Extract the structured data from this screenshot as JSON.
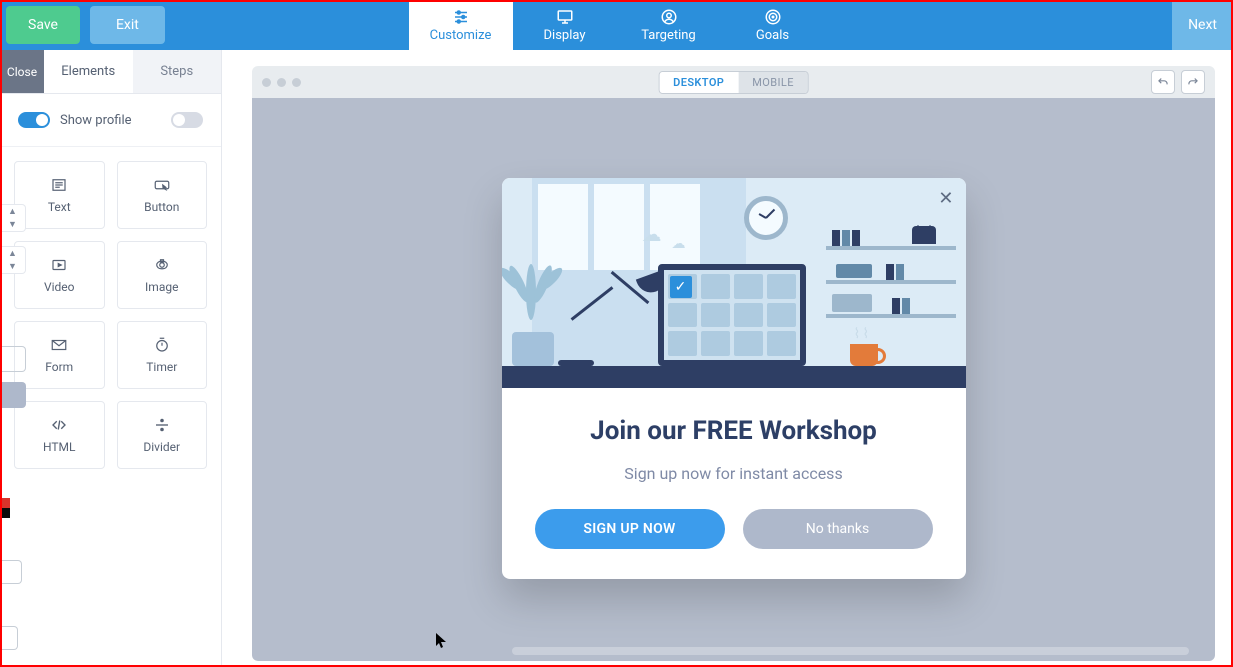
{
  "topbar": {
    "save": "Save",
    "exit": "Exit",
    "next": "Next",
    "nav": [
      {
        "label": "Customize",
        "icon": "sliders",
        "active": true
      },
      {
        "label": "Display",
        "icon": "monitor",
        "active": false
      },
      {
        "label": "Targeting",
        "icon": "target-user",
        "active": false
      },
      {
        "label": "Goals",
        "icon": "bullseye",
        "active": false
      }
    ]
  },
  "sidebar": {
    "tabs": {
      "close": "Close",
      "elements": "Elements",
      "steps": "Steps"
    },
    "active_tab": "Elements",
    "show_profile_label": "Show profile",
    "show_profile_enabled_left": true,
    "show_profile_enabled_right": false,
    "elements": [
      {
        "label": "Text",
        "icon": "text"
      },
      {
        "label": "Button",
        "icon": "button"
      },
      {
        "label": "Video",
        "icon": "video"
      },
      {
        "label": "Image",
        "icon": "image"
      },
      {
        "label": "Form",
        "icon": "form"
      },
      {
        "label": "Timer",
        "icon": "timer"
      },
      {
        "label": "HTML",
        "icon": "html"
      },
      {
        "label": "Divider",
        "icon": "divider"
      }
    ]
  },
  "preview": {
    "device": {
      "desktop": "DESKTOP",
      "mobile": "MOBILE",
      "active": "DESKTOP"
    },
    "actions": {
      "undo": "undo",
      "redo": "redo"
    }
  },
  "popup": {
    "title": "Join our FREE Workshop",
    "subtitle": "Sign up now for instant access",
    "primary": "SIGN UP NOW",
    "secondary": "No thanks",
    "close_glyph": "✕"
  },
  "colors": {
    "topbar": "#2b8fdb",
    "save": "#4ecb8f",
    "primary_btn": "#3c9cec",
    "secondary_btn": "#aeb8cb",
    "popup_title": "#2d3f66"
  }
}
